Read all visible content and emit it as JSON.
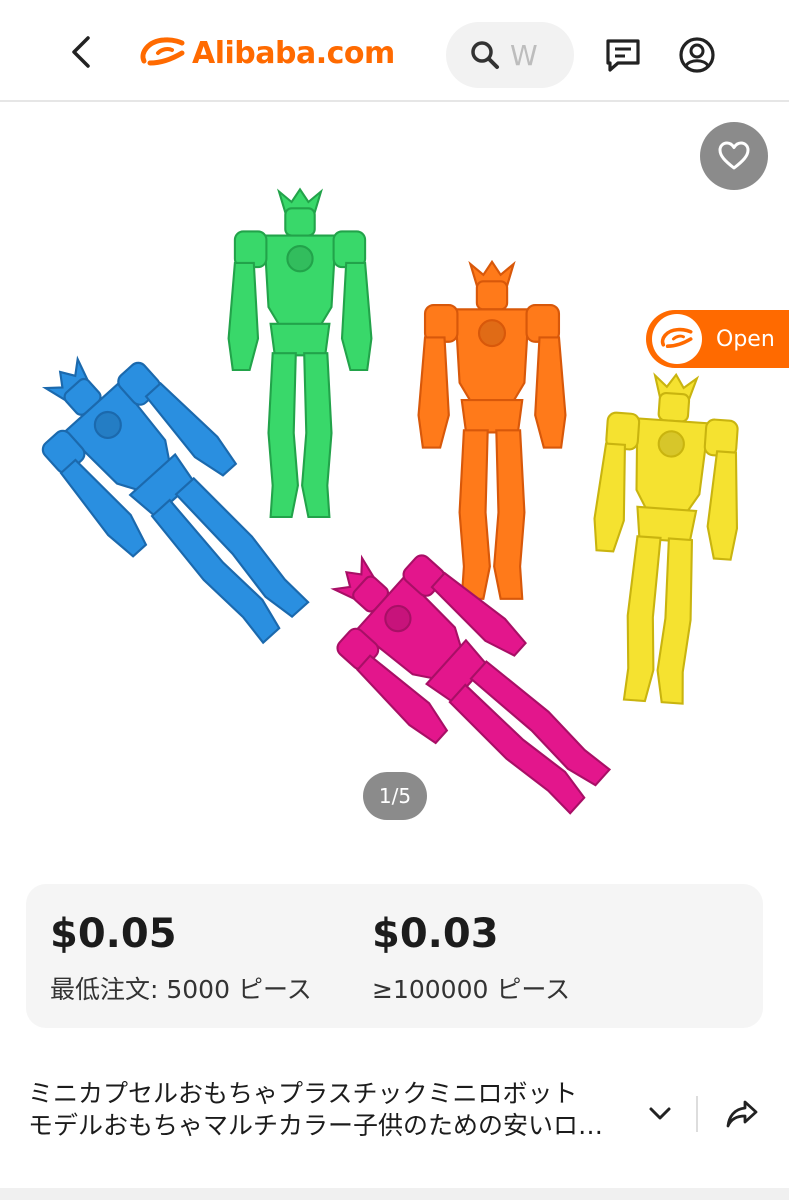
{
  "header": {
    "brand": "Alibaba.com",
    "search_placeholder": "W",
    "icons": {
      "back": "chevron-left-icon",
      "search": "search-icon",
      "messages": "message-icon",
      "account": "user-icon"
    },
    "accent_color": "#ff6a00"
  },
  "gallery": {
    "page_indicator": "1/5",
    "open_button_label": "Open",
    "favorite_icon": "heart-icon",
    "figures": [
      {
        "color": "#39d86a"
      },
      {
        "color": "#ff7a1a"
      },
      {
        "color": "#2a8fe0"
      },
      {
        "color": "#f5e230"
      },
      {
        "color": "#e3168c"
      }
    ]
  },
  "pricing": {
    "tiers": [
      {
        "price": "$0.05",
        "quantity": "最低注文: 5000 ピース"
      },
      {
        "price": "$0.03",
        "quantity": "≥100000 ピース"
      }
    ]
  },
  "product": {
    "title_line1": "ミニカプセルおもちゃプラスチックミニロボット",
    "title_line2": "モデルおもちゃマルチカラー子供のための安いロ…",
    "icons": {
      "expand": "chevron-down-icon",
      "share": "share-icon"
    }
  }
}
